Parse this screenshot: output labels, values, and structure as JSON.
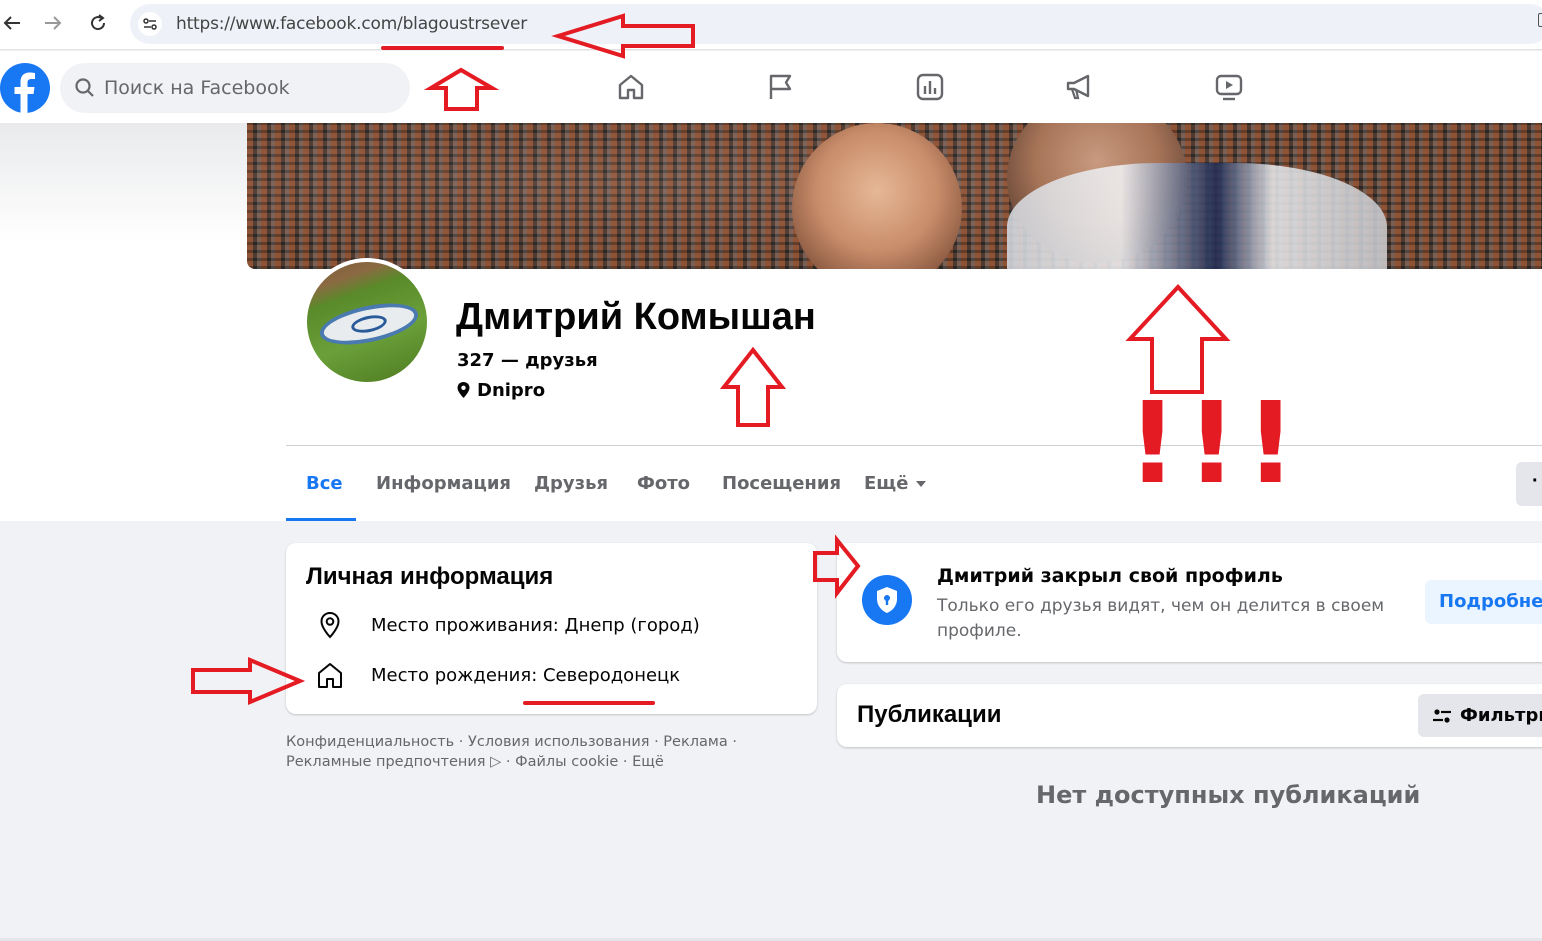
{
  "browser": {
    "url": "https://www.facebook.com/blagoustrsever"
  },
  "header": {
    "search_placeholder": "Поиск на Facebook",
    "nav_icons": [
      "home-icon",
      "flag-icon",
      "dashboard-icon",
      "megaphone-icon",
      "video-icon"
    ]
  },
  "profile": {
    "name": "Дмитрий Комышан",
    "friends": "327 — друзья",
    "location": "Dnipro"
  },
  "tabs": [
    {
      "label": "Все",
      "active": true
    },
    {
      "label": "Информация"
    },
    {
      "label": "Друзья"
    },
    {
      "label": "Фото"
    },
    {
      "label": "Посещения"
    },
    {
      "label": "Ещё"
    }
  ],
  "more_button": "·",
  "intro": {
    "title": "Личная информация",
    "residence": "Место проживания: Днепр (город)",
    "birthplace": "Место рождения: Северодонецк"
  },
  "footer": {
    "links_line1": "Конфиденциальность · Условия использования · Реклама ·",
    "links_line2": "Рекламные предпочтения ▷ · Файлы cookie · Ещё"
  },
  "locked": {
    "title": "Дмитрий закрыл свой профиль",
    "description": "Только его друзья видят, чем он делится в своем профиле.",
    "button": "Подробнее"
  },
  "posts": {
    "title": "Публикации",
    "filters": "Фильтры",
    "empty": "Нет доступных публикаций"
  },
  "annotations": {
    "exclamation": "!!!",
    "color": "#e41b23"
  },
  "colors": {
    "brand": "#1877f2",
    "background": "#f0f2f5"
  }
}
